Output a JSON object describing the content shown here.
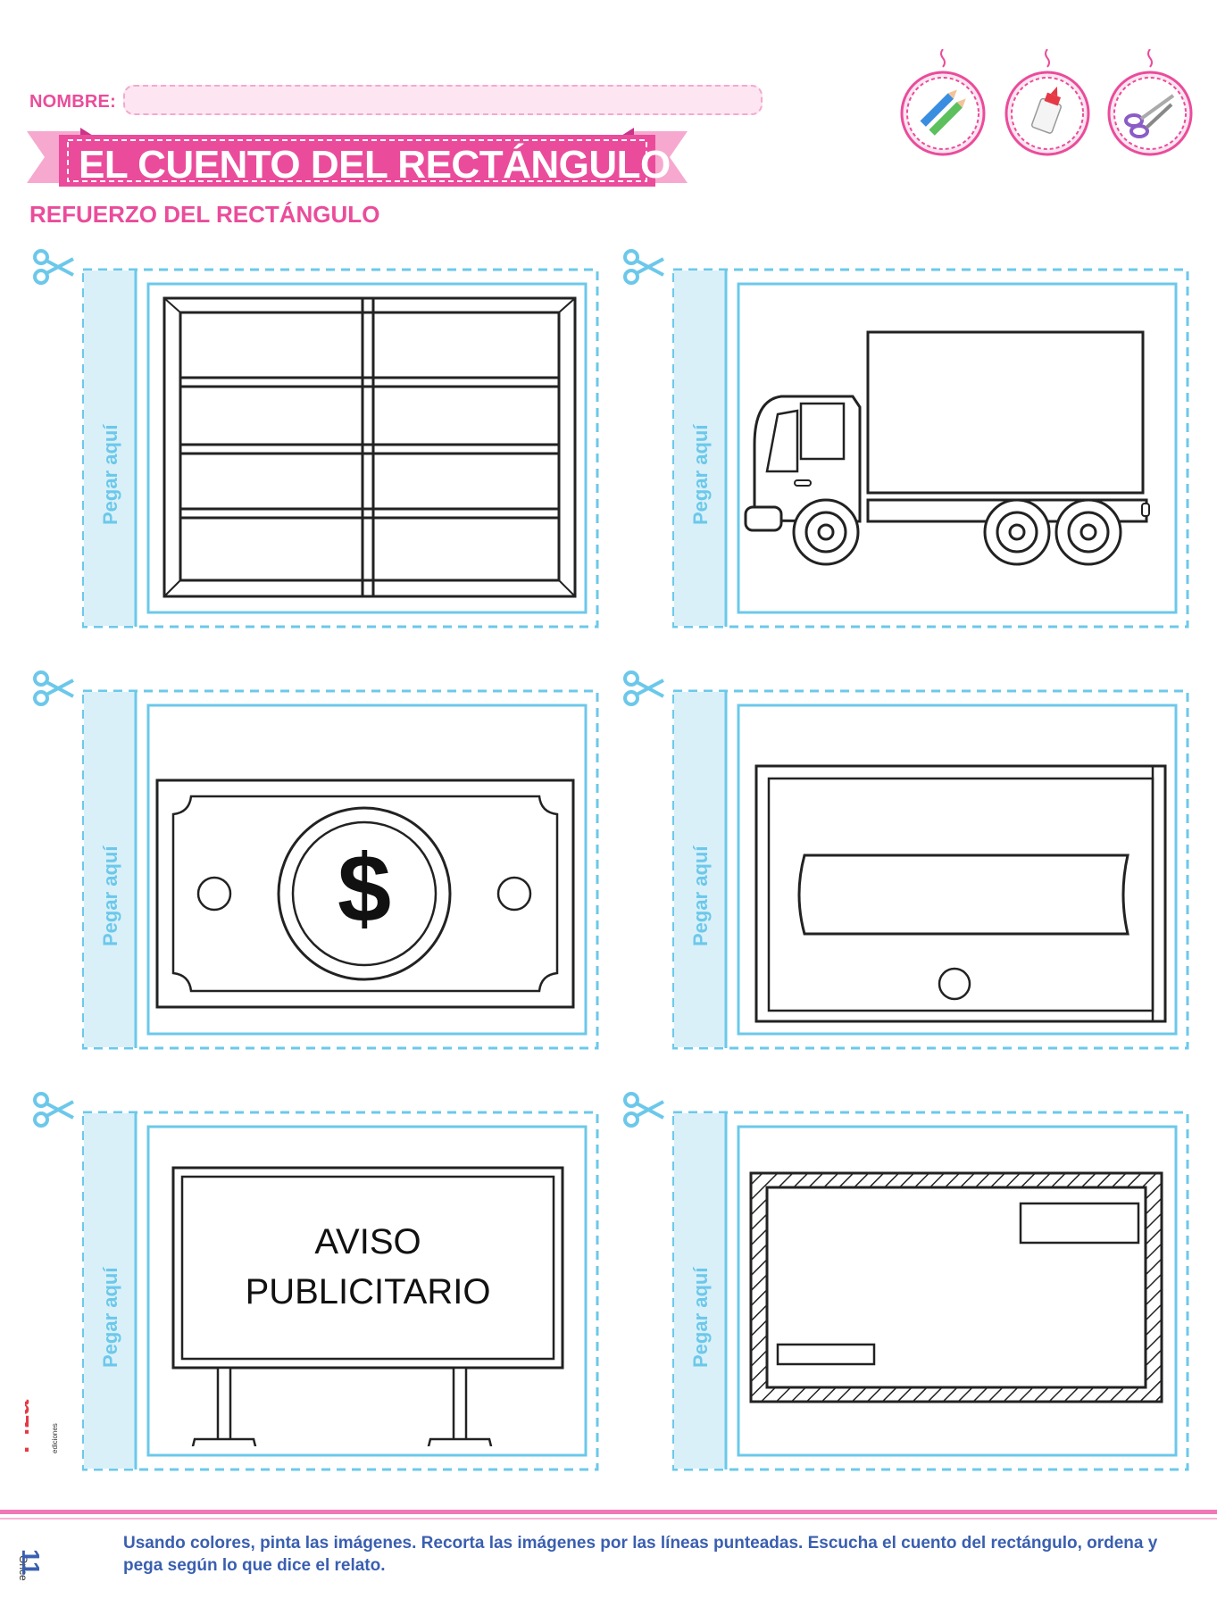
{
  "header": {
    "name_label": "NOMBRE:",
    "title": "EL CUENTO DEL RECTÁNGULO",
    "subtitle": "REFUERZO DEL RECTÁNGULO"
  },
  "tools": [
    {
      "icon": "crayons-icon"
    },
    {
      "icon": "glue-icon"
    },
    {
      "icon": "scissors-icon"
    }
  ],
  "cards": [
    {
      "glue_label": "Pegar aquí",
      "illustration": "window-icon"
    },
    {
      "glue_label": "Pegar aquí",
      "illustration": "truck-icon"
    },
    {
      "glue_label": "Pegar aquí",
      "illustration": "dollar-bill-icon"
    },
    {
      "glue_label": "Pegar aquí",
      "illustration": "mailbox-icon"
    },
    {
      "glue_label": "Pegar aquí",
      "illustration": "billboard-icon",
      "sign_line1": "AVISO",
      "sign_line2": "PUBLICITARIO"
    },
    {
      "glue_label": "Pegar aquí",
      "illustration": "envelope-icon"
    }
  ],
  "footer": {
    "instructions": "Usando colores, pinta las imágenes. Recorta las imágenes por las líneas punteadas. Escucha el cuento del rectángulo, ordena y pega según lo que dice el relato.",
    "page_number": "11",
    "page_word": "Once",
    "brand": "Piza ediciones"
  },
  "colors": {
    "pink": "#ea4c9b",
    "light_pink": "#fde6f1",
    "cyan": "#6cc8ea",
    "light_cyan": "#d9f0f9",
    "blue_text": "#3a5fb0",
    "brand_red": "#e63946"
  }
}
